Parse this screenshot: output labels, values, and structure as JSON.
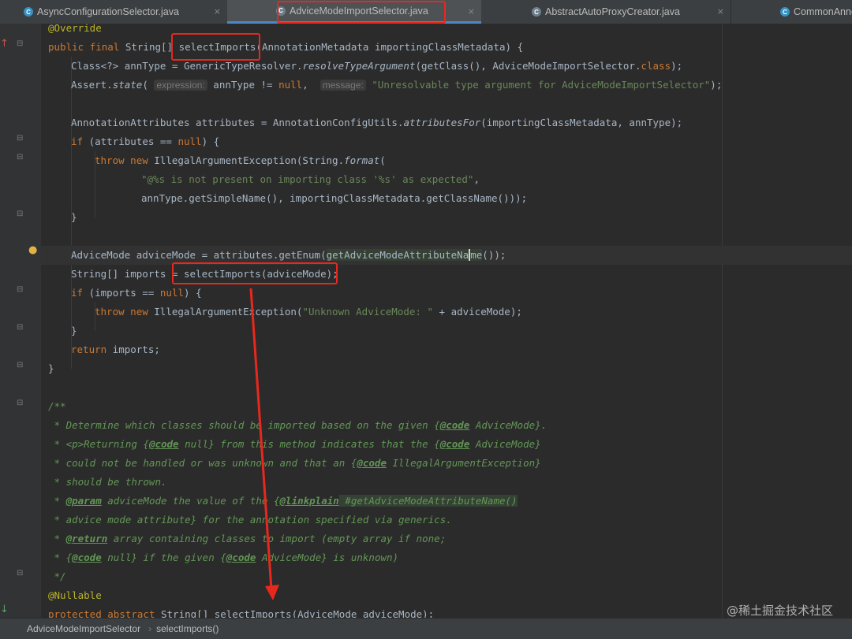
{
  "tabs": [
    {
      "label": "AsyncConfigurationSelector.java",
      "close": "×"
    },
    {
      "label": "AdviceModeImportSelector.java",
      "close": "×"
    },
    {
      "label": "AbstractAutoProxyCreator.java",
      "close": "×"
    },
    {
      "label": "CommonAnno"
    }
  ],
  "code": {
    "l1": {
      "ann": "@Override"
    },
    "l2": {
      "k1": "public",
      "k2": "final",
      "t1": " String[] ",
      "m": "selectImports",
      "t2": "(AnnotationMetadata importingClassMetadata) {"
    },
    "l3": {
      "t1": "Class<?> annType = GenericTypeResolver.",
      "i1": "resolveTypeArgument",
      "t2": "(getClass(), AdviceModeImportSelector.",
      "k1": "class",
      "t3": ");"
    },
    "l4": {
      "t1": "Assert.",
      "i1": "state",
      "t2": "( ",
      "h1": "expression:",
      "t3": " annType != ",
      "k1": "null",
      "t4": ",  ",
      "h2": "message:",
      "s1": " \"Unresolvable type argument for AdviceModeImportSelector\"",
      "t5": ");"
    },
    "l6": {
      "t1": "AnnotationAttributes attributes = AnnotationConfigUtils.",
      "i1": "attributesFor",
      "t2": "(importingClassMetadata, annType);"
    },
    "l7": {
      "k1": "if",
      "t1": " (attributes == ",
      "k2": "null",
      "t2": ") {"
    },
    "l8": {
      "k1": "throw",
      "k2": "new",
      "t1": " IllegalArgumentException(String.",
      "i1": "format",
      "t2": "("
    },
    "l9": {
      "s1": "\"@%s is not present on importing class '%s' as expected\"",
      "t1": ","
    },
    "l10": {
      "t1": "annType.getSimpleName(), importingClassMetadata.getClassName()));"
    },
    "l11": {
      "t1": "}"
    },
    "l13": {
      "t1": "AdviceMode adviceMode = attributes.getEnum(",
      "e1": "getAdviceModeAttributeNa",
      "e2": "me",
      "t2": "());"
    },
    "l14": {
      "t1": "String[] imports = ",
      "t2": "selectImports(adviceMode);"
    },
    "l15": {
      "k1": "if",
      "t1": " (imports == ",
      "k2": "null",
      "t2": ") {"
    },
    "l16": {
      "k1": "throw",
      "k2": "new",
      "t1": " IllegalArgumentException(",
      "s1": "\"Unknown AdviceMode: \"",
      "t2": " + adviceMode);"
    },
    "l17": {
      "t1": "}"
    },
    "l18": {
      "k1": "return",
      "t1": " imports;"
    },
    "l19": {
      "t1": "}"
    },
    "l21": {
      "d1": "/**"
    },
    "l22": {
      "d1": " * Determine which classes should be imported based on the given {",
      "g1": "@code",
      "d2": " AdviceMode}."
    },
    "l23": {
      "d1": " * <p>Returning {",
      "g1": "@code",
      "d2": " null} from this method indicates that the {",
      "g2": "@code",
      "d3": " AdviceMode}"
    },
    "l24": {
      "d1": " * could not be handled or was unknown and that an {",
      "g1": "@code",
      "d2": " IllegalArgumentException}"
    },
    "l25": {
      "d1": " * should be thrown."
    },
    "l26": {
      "d1": " * ",
      "g1": "@param",
      "d2": " adviceMode the value of the {",
      "g2": "@linkplain",
      "d3": " #getAdviceModeAttributeName()"
    },
    "l27": {
      "d1": " * advice mode attribute} for the annotation specified via generics."
    },
    "l28": {
      "d1": " * ",
      "g1": "@return",
      "d2": " array containing classes to import (empty array if none;"
    },
    "l29": {
      "d1": " * {",
      "g1": "@code",
      "d2": " null} if the given {",
      "g2": "@code",
      "d3": " AdviceMode} is unknown)"
    },
    "l30": {
      "d1": " */"
    },
    "l31": {
      "ann": "@Nullable"
    },
    "l32": {
      "k1": "protected",
      "k2": "abstract",
      "t1": " String[] ",
      "m": "selectImports",
      "t2": "(AdviceMode adviceMode);"
    }
  },
  "breadcrumb": {
    "class": "AdviceModeImportSelector",
    "sep": "›",
    "method": "selectImports()"
  },
  "watermark": "@稀土掘金技术社区",
  "colors": {
    "keyword": "#cc7832",
    "annotation": "#bbb529",
    "string": "#6a8759",
    "doc": "#629755",
    "highlight": "#e8281e"
  },
  "icons": [
    "class-icon",
    "close-icon",
    "bulb-icon",
    "fold-icon",
    "override-arrow-icon",
    "implement-arrow-icon"
  ]
}
